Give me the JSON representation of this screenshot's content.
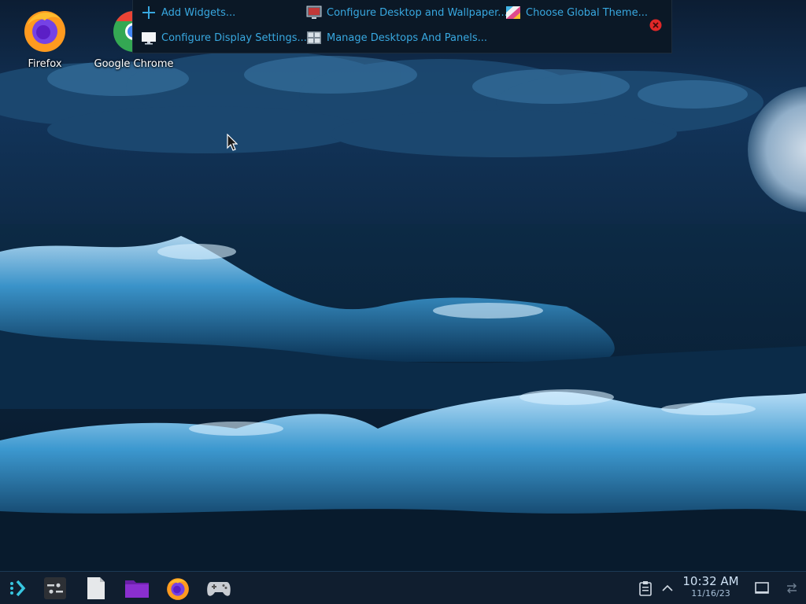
{
  "desktop": {
    "icons": [
      {
        "label": "Firefox",
        "icon": "firefox-icon"
      },
      {
        "label": "Google Chrome",
        "icon": "chrome-icon"
      }
    ]
  },
  "toolbox": {
    "items": [
      {
        "label": "Add Widgets...",
        "icon": "add-icon"
      },
      {
        "label": "Configure Desktop and Wallpaper...",
        "icon": "monitor-wallpaper-icon"
      },
      {
        "label": "Choose Global Theme...",
        "icon": "theme-icon"
      },
      {
        "label": "Configure Display Settings...",
        "icon": "display-icon"
      },
      {
        "label": "Manage Desktops And Panels...",
        "icon": "desktops-panels-icon"
      }
    ],
    "close_icon": "close-icon"
  },
  "taskbar": {
    "launcher_icon": "application-launcher-icon",
    "apps": [
      {
        "name": "System Settings",
        "icon": "settings-icon"
      },
      {
        "name": "Files",
        "icon": "document-icon"
      },
      {
        "name": "File Manager",
        "icon": "folder-icon"
      },
      {
        "name": "Firefox",
        "icon": "firefox-icon"
      },
      {
        "name": "Games",
        "icon": "gamepad-icon"
      }
    ],
    "tray": {
      "clipboard_icon": "clipboard-icon",
      "expand_icon": "chevron-up-icon",
      "show_desktop_icon": "show-desktop-icon",
      "switch_icon": "switch-icon"
    },
    "clock": {
      "time": "10:32 AM",
      "date": "11/16/23"
    }
  },
  "colors": {
    "accent": "#38a8e0",
    "taskbar_bg": "#101e2f",
    "toolbox_bg": "#0b1826",
    "close_red": "#e02828"
  }
}
